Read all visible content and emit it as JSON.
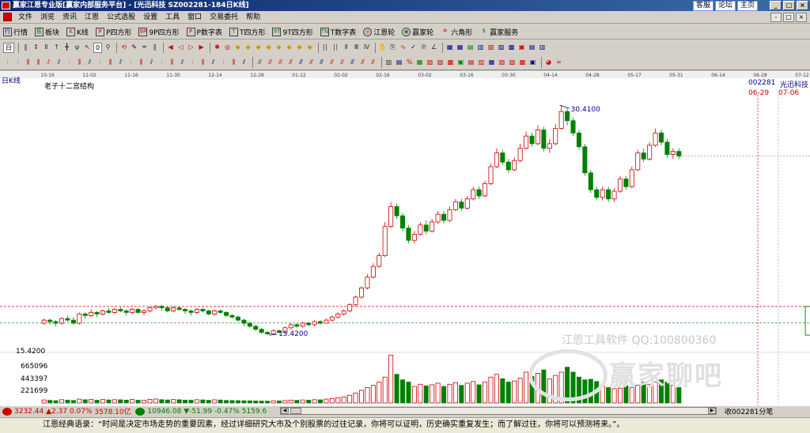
{
  "window": {
    "title": "赢家江恩专业版[赢家内部服务平台] - [光迅科技   SZ002281-184日K线]",
    "links": [
      "客服",
      "论坛",
      "主页"
    ],
    "buttons": [
      "_",
      "□",
      "×"
    ]
  },
  "menu": {
    "items": [
      "文件",
      "浏览",
      "资讯",
      "江恩",
      "公式选股",
      "设置",
      "工具",
      "窗口",
      "交易委托",
      "帮助"
    ],
    "right_buttons": [
      "-",
      "□",
      "×"
    ]
  },
  "toolbar1": {
    "items": [
      {
        "icon": "行",
        "label": "行情"
      },
      {
        "icon": "板",
        "label": "板块"
      },
      {
        "icon": "K",
        "label": "K线"
      },
      {
        "icon": "P",
        "label": "P四方形"
      },
      {
        "icon": "9P",
        "label": "9P四方形"
      },
      {
        "icon": "P",
        "label": "P数字表"
      },
      {
        "icon": "T",
        "label": "T四方形"
      },
      {
        "icon": "9T",
        "label": "9T四方形"
      },
      {
        "icon": "TN",
        "label": "T数字表"
      },
      {
        "icon": "◎",
        "label": "江恩轮"
      },
      {
        "icon": "◉",
        "label": "赢家轮"
      },
      {
        "icon": "✡",
        "label": "六角形"
      },
      {
        "icon": "$",
        "label": "赢家服务"
      }
    ]
  },
  "toolbar2": {
    "period_selector": "日",
    "zoom_selector": "0"
  },
  "chart": {
    "period_label": "日K线",
    "indicator_name": "老子十二宫结构",
    "stock_code": "002281",
    "stock_name": "光迅科技",
    "date_range_start": "06-29",
    "date_range_end": "07-06",
    "y_axis_label": "15.4200",
    "volume_ticks": [
      "665096",
      "443397",
      "221699"
    ],
    "top_date_ticks": [
      "10-19",
      "11-02",
      "11-16",
      "11-30",
      "12-14",
      "12-28",
      "01-12",
      "02-02",
      "02-16",
      "03-02",
      "03-16",
      "03-30",
      "04-14",
      "04-28",
      "05-17",
      "05-31",
      "06-14",
      "06-28",
      "07-12"
    ],
    "annotations": {
      "high_price": "30.4100",
      "low_price": "15.4200",
      "box1_top": "17.29",
      "box1_bottom": "15.42",
      "box2_top": "20.58",
      "box2_bottom": "16.21"
    },
    "watermark_text": "江恩工具软件  QQ:100800360",
    "watermark_brand": "赢家聊吧",
    "colors": {
      "up": "#cc0000",
      "down": "#008000",
      "grid_red": "#cc0000",
      "grid_green": "#008000",
      "text_blue": "#00008b"
    }
  },
  "chart_data": {
    "type": "candlestick",
    "title": "老子十二宫结构",
    "ylabel": "",
    "ylim": [
      14.5,
      31.5
    ],
    "reference_lines": [
      {
        "value": 17.29,
        "color": "#cc0000"
      },
      {
        "value": 16.21,
        "color": "#008000"
      }
    ],
    "boxes": [
      {
        "from": 130,
        "to": 142,
        "low": 15.42,
        "high": 17.29,
        "color": "#008000"
      },
      {
        "from": 182,
        "to": 210,
        "low": 16.21,
        "high": 20.58,
        "color": "#cc0000"
      }
    ],
    "candles": [
      [
        16.2,
        16.4,
        16.5,
        16.1
      ],
      [
        16.4,
        16.3,
        16.5,
        16.1
      ],
      [
        16.3,
        16.2,
        16.4,
        16.0
      ],
      [
        16.2,
        16.5,
        16.6,
        16.1
      ],
      [
        16.5,
        16.4,
        16.7,
        16.3
      ],
      [
        16.4,
        16.2,
        16.6,
        16.1
      ],
      [
        16.2,
        16.8,
        16.9,
        16.1
      ],
      [
        16.8,
        16.7,
        16.9,
        16.5
      ],
      [
        16.7,
        16.9,
        17.1,
        16.6
      ],
      [
        16.9,
        16.8,
        17.0,
        16.6
      ],
      [
        16.8,
        17.0,
        17.1,
        16.7
      ],
      [
        17.0,
        16.9,
        17.2,
        16.8
      ],
      [
        16.9,
        17.1,
        17.2,
        16.8
      ],
      [
        17.1,
        17.0,
        17.3,
        16.9
      ],
      [
        17.0,
        16.9,
        17.1,
        16.7
      ],
      [
        16.9,
        17.1,
        17.2,
        16.8
      ],
      [
        17.1,
        16.9,
        17.2,
        16.8
      ],
      [
        16.9,
        17.0,
        17.1,
        16.7
      ],
      [
        17.0,
        17.2,
        17.3,
        16.9
      ],
      [
        17.2,
        17.3,
        17.4,
        17.1
      ],
      [
        17.3,
        17.2,
        17.4,
        17.0
      ],
      [
        17.2,
        17.0,
        17.3,
        16.9
      ],
      [
        17.0,
        17.2,
        17.3,
        16.9
      ],
      [
        17.2,
        17.1,
        17.3,
        17.0
      ],
      [
        17.1,
        17.0,
        17.2,
        16.8
      ],
      [
        17.0,
        16.9,
        17.1,
        16.7
      ],
      [
        16.9,
        17.1,
        17.2,
        16.8
      ],
      [
        17.1,
        17.0,
        17.2,
        16.9
      ],
      [
        17.0,
        16.8,
        17.1,
        16.7
      ],
      [
        16.8,
        17.0,
        17.1,
        16.7
      ],
      [
        17.0,
        16.9,
        17.1,
        16.8
      ],
      [
        16.9,
        16.7,
        17.0,
        16.6
      ],
      [
        16.7,
        16.6,
        16.8,
        16.5
      ],
      [
        16.6,
        16.4,
        16.7,
        16.3
      ],
      [
        16.4,
        16.2,
        16.5,
        16.0
      ],
      [
        16.2,
        16.0,
        16.3,
        15.9
      ],
      [
        16.0,
        15.8,
        16.1,
        15.7
      ],
      [
        15.8,
        15.6,
        15.9,
        15.5
      ],
      [
        15.6,
        15.5,
        15.7,
        15.42
      ],
      [
        15.5,
        15.7,
        15.8,
        15.42
      ],
      [
        15.7,
        15.6,
        15.8,
        15.5
      ],
      [
        15.6,
        15.9,
        16.0,
        15.5
      ],
      [
        15.9,
        16.1,
        16.2,
        15.8
      ],
      [
        16.1,
        16.0,
        16.2,
        15.9
      ],
      [
        16.0,
        16.2,
        16.3,
        15.9
      ],
      [
        16.2,
        16.1,
        16.3,
        16.0
      ],
      [
        16.1,
        16.3,
        16.4,
        16.0
      ],
      [
        16.3,
        16.2,
        16.4,
        16.1
      ],
      [
        16.2,
        16.4,
        16.5,
        16.21
      ],
      [
        16.4,
        16.6,
        16.7,
        16.3
      ],
      [
        16.6,
        16.8,
        16.9,
        16.5
      ],
      [
        16.8,
        17.0,
        17.1,
        16.7
      ],
      [
        17.0,
        17.4,
        17.5,
        16.9
      ],
      [
        17.4,
        17.9,
        18.0,
        17.3
      ],
      [
        17.9,
        18.5,
        18.6,
        17.8
      ],
      [
        18.5,
        19.2,
        19.4,
        18.4
      ],
      [
        19.2,
        19.9,
        20.1,
        19.1
      ],
      [
        19.9,
        20.6,
        20.8,
        19.8
      ],
      [
        20.6,
        22.5,
        22.8,
        20.5
      ],
      [
        22.5,
        23.8,
        24.1,
        22.4
      ],
      [
        23.8,
        23.2,
        24.0,
        23.0
      ],
      [
        23.2,
        22.4,
        23.4,
        22.2
      ],
      [
        22.4,
        21.6,
        22.6,
        21.4
      ],
      [
        21.6,
        22.0,
        22.2,
        21.4
      ],
      [
        22.0,
        22.6,
        22.8,
        21.9
      ],
      [
        22.6,
        22.2,
        22.9,
        22.0
      ],
      [
        22.2,
        22.8,
        23.0,
        22.1
      ],
      [
        22.8,
        23.3,
        23.5,
        22.7
      ],
      [
        23.3,
        22.9,
        23.5,
        22.7
      ],
      [
        22.9,
        23.6,
        23.8,
        22.8
      ],
      [
        23.6,
        24.1,
        24.3,
        23.5
      ],
      [
        24.1,
        23.7,
        24.3,
        23.5
      ],
      [
        23.7,
        24.3,
        24.5,
        23.6
      ],
      [
        24.3,
        24.9,
        25.1,
        24.2
      ],
      [
        24.9,
        24.5,
        25.1,
        24.3
      ],
      [
        24.5,
        25.3,
        25.5,
        24.4
      ],
      [
        25.3,
        26.4,
        26.6,
        25.2
      ],
      [
        26.4,
        27.3,
        27.6,
        26.3
      ],
      [
        27.3,
        26.7,
        27.5,
        26.5
      ],
      [
        26.7,
        26.2,
        26.9,
        26.0
      ],
      [
        26.2,
        26.8,
        27.0,
        26.1
      ],
      [
        26.8,
        27.6,
        27.9,
        26.7
      ],
      [
        27.6,
        28.4,
        28.7,
        27.5
      ],
      [
        28.4,
        27.9,
        28.6,
        27.7
      ],
      [
        27.9,
        28.8,
        29.1,
        27.8
      ],
      [
        28.8,
        27.6,
        29.0,
        27.4
      ],
      [
        27.6,
        27.9,
        28.2,
        27.3
      ],
      [
        27.9,
        28.9,
        29.2,
        27.8
      ],
      [
        28.9,
        30.0,
        30.41,
        28.8
      ],
      [
        30.0,
        29.4,
        30.2,
        29.1
      ],
      [
        29.4,
        28.6,
        29.6,
        28.4
      ],
      [
        28.6,
        27.7,
        28.8,
        27.5
      ],
      [
        27.7,
        26.0,
        27.9,
        25.8
      ],
      [
        26.0,
        24.9,
        26.2,
        24.7
      ],
      [
        24.9,
        24.4,
        25.1,
        24.2
      ],
      [
        24.4,
        24.9,
        25.1,
        24.2
      ],
      [
        24.9,
        24.3,
        25.1,
        24.1
      ],
      [
        24.3,
        24.8,
        25.0,
        24.1
      ],
      [
        24.8,
        25.6,
        25.8,
        24.7
      ],
      [
        25.6,
        25.1,
        25.8,
        24.9
      ],
      [
        25.1,
        26.2,
        26.4,
        25.0
      ],
      [
        26.2,
        27.3,
        27.5,
        26.1
      ],
      [
        27.3,
        26.9,
        27.6,
        26.7
      ],
      [
        26.9,
        27.8,
        28.0,
        26.8
      ],
      [
        27.8,
        28.6,
        28.9,
        27.7
      ],
      [
        28.6,
        28.0,
        28.8,
        27.8
      ],
      [
        28.0,
        27.2,
        28.2,
        27.0
      ],
      [
        27.2,
        27.4,
        27.6,
        26.9
      ],
      [
        27.4,
        27.1,
        27.6,
        26.9
      ]
    ]
  },
  "volume_data": {
    "ylim": [
      0,
      890000
    ],
    "values": [
      55000,
      48000,
      42000,
      60000,
      52000,
      45000,
      70000,
      58000,
      66000,
      50000,
      62000,
      55000,
      60000,
      58000,
      52000,
      64000,
      50000,
      48000,
      66000,
      72000,
      60000,
      55000,
      63000,
      58000,
      52000,
      50000,
      60000,
      56000,
      48000,
      58000,
      54000,
      46000,
      44000,
      42000,
      40000,
      38000,
      36000,
      34000,
      33000,
      40000,
      38000,
      45000,
      52000,
      48000,
      55000,
      50000,
      60000,
      57000,
      70000,
      82000,
      95000,
      110000,
      140000,
      180000,
      230000,
      280000,
      320000,
      380000,
      470000,
      870000,
      520000,
      420000,
      380000,
      300000,
      340000,
      310000,
      330000,
      360000,
      300000,
      340000,
      370000,
      320000,
      360000,
      390000,
      330000,
      380000,
      470000,
      520000,
      440000,
      380000,
      400000,
      450000,
      560000,
      480000,
      540000,
      600000,
      440000,
      500000,
      560000,
      650000,
      560000,
      470000,
      420000,
      430000,
      390000,
      300000,
      280000,
      260000,
      270000,
      310000,
      280000,
      320000,
      380000,
      340000,
      380000,
      420000,
      380000,
      320000,
      280000,
      240000
    ]
  },
  "status": {
    "index1": "3232.44",
    "change1": "▲2.37",
    "pct1": "0.07%",
    "amount1": "3578.10亿",
    "index2": "10946.08",
    "change2": "▼-51.99",
    "pct2": "-0.47%",
    "amount2": "5159.6",
    "right_text": "收002281分笔"
  },
  "quote": "江恩经典语录：“时间是决定市场走势的重要因素，经过详细研究大市及个别股票的过往记录，你将可以证明，历史确实重复发生；而了解过往，你将可以预测将来。”。"
}
